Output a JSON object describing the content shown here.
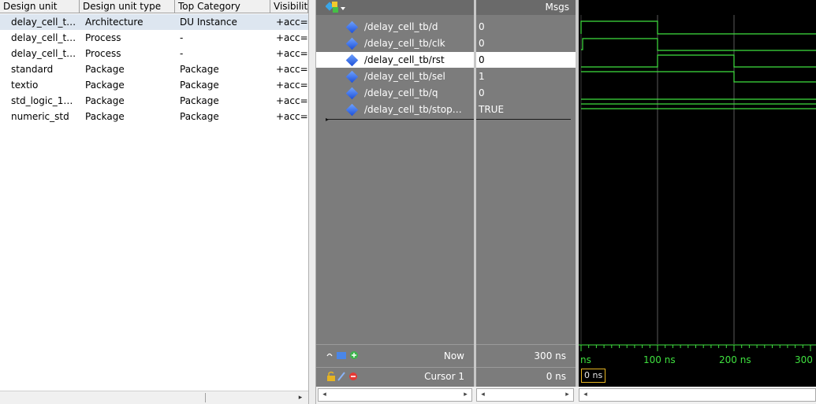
{
  "library": {
    "columns": [
      "Design unit",
      "Design unit type",
      "Top Category",
      "Visibilit"
    ],
    "rows": [
      {
        "unit": "delay_cell_t…",
        "type": "Architecture",
        "category": "DU Instance",
        "visibility": "+acc="
      },
      {
        "unit": "delay_cell_t…",
        "type": "Process",
        "category": "-",
        "visibility": "+acc="
      },
      {
        "unit": "delay_cell_t…",
        "type": "Process",
        "category": "-",
        "visibility": "+acc="
      },
      {
        "unit": "standard",
        "type": "Package",
        "category": "Package",
        "visibility": "+acc="
      },
      {
        "unit": "textio",
        "type": "Package",
        "category": "Package",
        "visibility": "+acc="
      },
      {
        "unit": "std_logic_1…",
        "type": "Package",
        "category": "Package",
        "visibility": "+acc="
      },
      {
        "unit": "numeric_std",
        "type": "Package",
        "category": "Package",
        "visibility": "+acc="
      }
    ],
    "selected_row": 0
  },
  "wave": {
    "msgs_label": "Msgs",
    "signals": [
      {
        "name": "/delay_cell_tb/d",
        "value": "0"
      },
      {
        "name": "/delay_cell_tb/clk",
        "value": "0"
      },
      {
        "name": "/delay_cell_tb/rst",
        "value": "0"
      },
      {
        "name": "/delay_cell_tb/sel",
        "value": "1"
      },
      {
        "name": "/delay_cell_tb/q",
        "value": "0"
      },
      {
        "name": "/delay_cell_tb/stop…",
        "value": "TRUE"
      }
    ],
    "selected_signal": 2,
    "now_label": "Now",
    "now_value": "300 ns",
    "cursor_label": "Cursor 1",
    "cursor_value": "0 ns",
    "cursor_marker": "0 ns",
    "ruler_ticks": [
      "ns",
      "100 ns",
      "200 ns",
      "300"
    ],
    "accent_colors": {
      "wave": "#3fe03f",
      "background": "#000000",
      "panel": "#7c7c7c"
    }
  }
}
